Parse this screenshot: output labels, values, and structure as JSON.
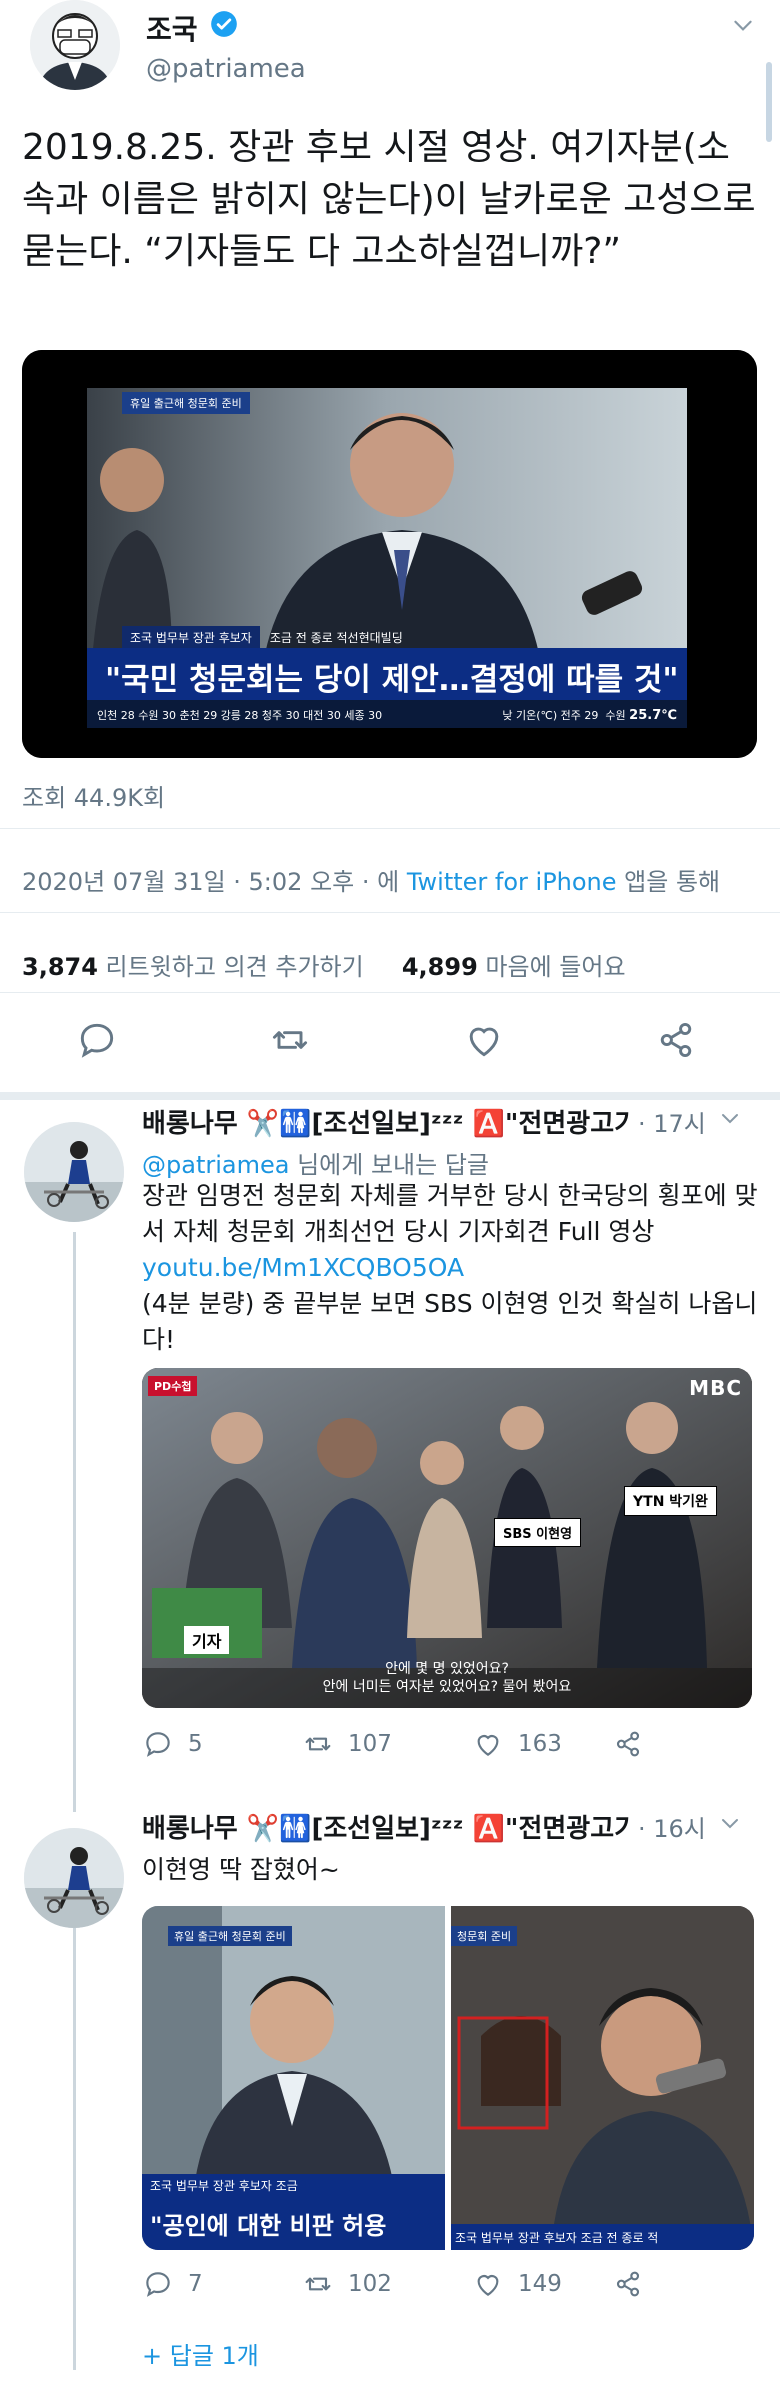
{
  "main_tweet": {
    "name": "조국",
    "handle": "@patriamea",
    "text": "2019.8.25. 장관 후보 시절 영상. 여기자분(소속과 이름은 밝히지 않는다)이 날카로운 고성으로 묻는다. “기자들도 다 고소하실껍니까?”",
    "video": {
      "top_tag": "휴일 출근해 청문회 준비",
      "subtitle_small": "조국 법무부 장관 후보자",
      "subtitle_small_right": "조금 전 종로 적선현대빌딩",
      "headline": "\"국민 청문회는 당이 제안…결정에 따를 것\"",
      "weather_ticker": "인천 28 수원 30 춘천 29 강릉 28 청주 30 대전 30 세종 30",
      "weather_right": "낮 기온(℃) 전주 29",
      "temp": "25.7℃",
      "temp_label": "수원"
    },
    "views": "조회 44.9K회",
    "date": "2020년 07월 31일 · 5:02 오후 · 에 ",
    "client": "Twitter for iPhone",
    "date_suffix": " 앱을 통해",
    "retweets": "3,874",
    "retweets_label": " 리트윗하고 의견 추가하기",
    "likes": "4,899",
    "likes_label": " 마음에 들어요"
  },
  "replies": [
    {
      "name": "배롱나무 ✂️🚻[조선일보]ᶻᶻᶻ 🅰️\"전면광고기...",
      "time": "· 17시",
      "reply_to_prefix": "",
      "reply_to_mention": "@patriamea",
      "reply_to_suffix": " 님에게 보내는 답글",
      "text_line1": "장관 임명전 청문회 자체를 거부한 당시 한국당의 횡포에 맞서 자체 청문회 개최선언 당시 기자회견 Full 영상",
      "link": "youtu.be/Mm1XCQBO5OA",
      "text_line2": " (4분 분량) 중 끝부분 보면 SBS 이현영 인것 확실히 나옵니다!",
      "image": {
        "logo": "MBC",
        "corner_tag": "PD수첩",
        "label_sbs": "SBS 이현영",
        "label_ytn": "YTN 박기완",
        "label_reporter": "기자",
        "caption1": "안에 몇 명 있었어요?",
        "caption2": "안에 너미든 여자분 있었어요? 물어 봤어요"
      },
      "comments": "5",
      "retweets": "107",
      "likes": "163"
    },
    {
      "name": "배롱나무 ✂️🚻[조선일보]ᶻᶻᶻ 🅰️\"전면광고기...",
      "time": "· 16시",
      "text": "이현영 딱 잡혔어~",
      "image_left": {
        "top_tag": "휴일 출근해 청문회 준비",
        "subtitle": "조국 법무부 장관 후보자  조금",
        "headline": "\"공인에 대한 비판 허용"
      },
      "image_right": {
        "top_tag": "청문회 준비",
        "subtitle": "조국 법무부 장관 후보자   조금 전 종로 적"
      },
      "comments": "7",
      "retweets": "102",
      "likes": "149",
      "more_replies": "+ 답글 1개"
    }
  ],
  "colors": {
    "accent": "#1b95e0",
    "secondary_text": "#657786",
    "divider": "#e6ecf0",
    "verified": "#1da1f2"
  }
}
